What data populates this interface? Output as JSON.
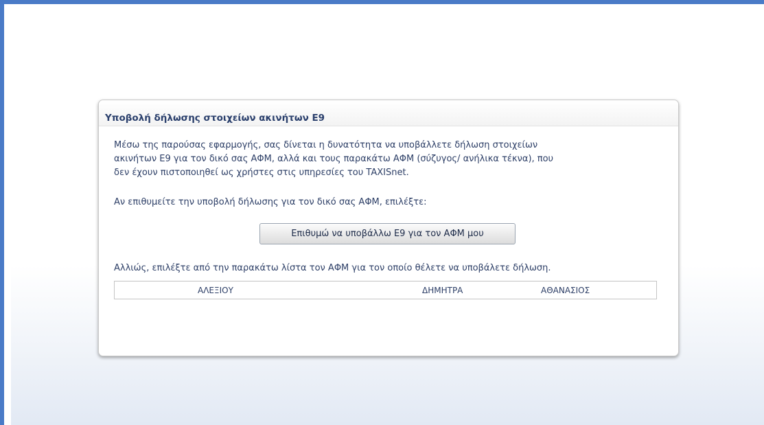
{
  "panel": {
    "title": "Υποβολή δήλωσης στοιχείων ακινήτων Ε9",
    "intro_line1": "Μέσω της παρούσας εφαρμογής, σας δίνεται η δυνατότητα να υποβάλλετε δήλωση στοιχείων",
    "intro_line2": "ακινήτων Ε9 για τον δικό σας ΑΦΜ, αλλά και τους παρακάτω ΑΦΜ (σύζυγος/ ανήλικα τέκνα), που",
    "intro_line3": "δεν έχουν πιστοποιηθεί ως χρήστες στις υπηρεσίες του TAXISnet.",
    "own_prompt": "Αν επιθυμείτε την υποβολή δήλωσης για τον δικό σας ΑΦΜ, επιλέξτε:",
    "own_button_label": "Επιθυμώ να υποβάλλω Ε9 για τον ΑΦΜ μου",
    "other_prompt": "Αλλιώς, επιλέξτε από την παρακάτω λίστα τον ΑΦΜ για τον οποίο θέλετε να υποβάλετε δήλωση.",
    "taxpayers": [
      {
        "surname": "ΑΛΕΞΙΟΥ",
        "first_name": "ΔΗΜΗΤΡΑ",
        "father_name": "ΑΘΑΝΑΣΙΟΣ"
      }
    ]
  },
  "colors": {
    "frame_border": "#4a7bc7",
    "title_text": "#2a3f6c",
    "body_text": "#2c3e66"
  }
}
